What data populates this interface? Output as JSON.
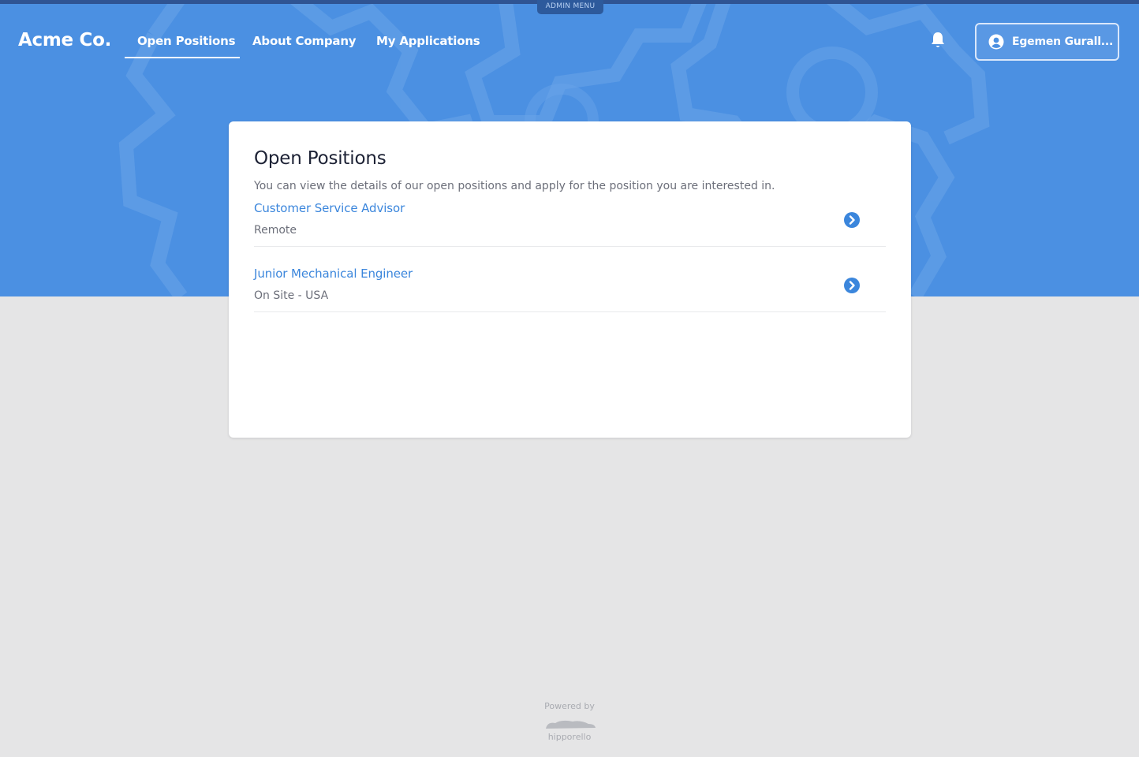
{
  "header": {
    "admin_menu": "ADMIN MENU",
    "brand": "Acme Co.",
    "nav": [
      {
        "label": "Open Positions",
        "active": true
      },
      {
        "label": "About Company",
        "active": false
      },
      {
        "label": "My Applications",
        "active": false
      }
    ],
    "user_name": "Egemen Gurall..."
  },
  "main": {
    "title": "Open Positions",
    "subtitle": "You can view the details of our open positions and apply for the position you are interested in.",
    "jobs": [
      {
        "title": "Customer Service Advisor",
        "location": "Remote"
      },
      {
        "title": "Junior Mechanical Engineer",
        "location": "On Site - USA"
      }
    ]
  },
  "footer": {
    "powered_by": "Powered by",
    "logo_text": "hipporello"
  },
  "colors": {
    "hero": "#4b90e2",
    "background": "#e5e5e6",
    "link": "#3b86dc",
    "admin_tab": "#2d5a9c"
  },
  "icons": [
    "bell-icon",
    "user-circle-icon",
    "chevron-right-circle-icon",
    "hipporello-logo"
  ]
}
